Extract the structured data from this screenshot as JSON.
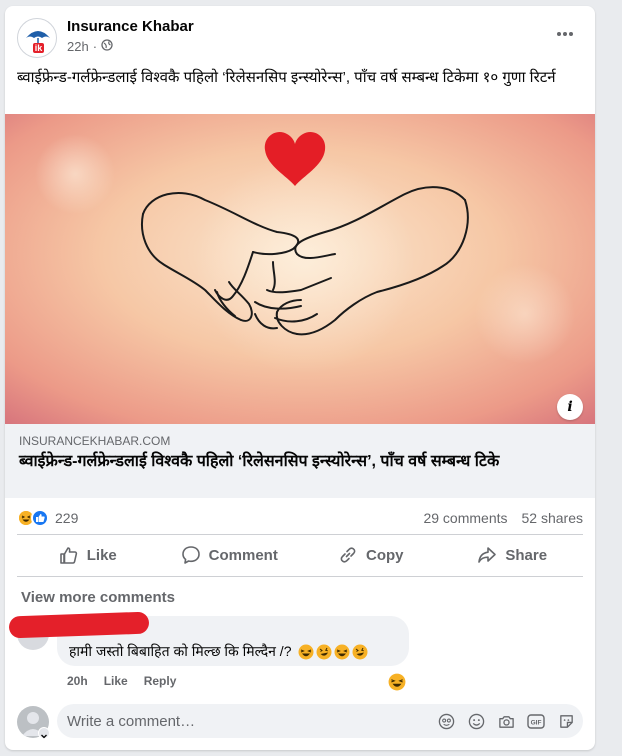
{
  "post": {
    "page_name": "Insurance Khabar",
    "time": "22h",
    "text": "ब्वाईफ्रेन्ड-गर्लफ्रेन्डलाई विश्वकै पहिलो ‘रिलेसनसिप इन्स्योरेन्स’, पाँच वर्ष सम्बन्ध टिकेमा १० गुणा रिटर्न",
    "logo_text": "ik",
    "image_icons": [
      "heart-icon",
      "hands-illustration"
    ]
  },
  "link": {
    "domain": "INSURANCEKHABAR.COM",
    "title": "ब्वाईफ्रेन्ड-गर्लफ्रेन्डलाई विश्वकै पहिलो ‘रिलेसनसिप इन्स्योरेन्स’, पाँच वर्ष सम्बन्ध टिके",
    "info_label": "i"
  },
  "stats": {
    "reaction_count": "229",
    "comments": "29 comments",
    "shares": "52 shares"
  },
  "actions": {
    "like": "Like",
    "comment": "Comment",
    "copy": "Copy",
    "share": "Share"
  },
  "comments": {
    "view_more": "View more comments",
    "items": [
      {
        "text": "हामी जस्तो बिबाहित को मिल्छ कि मिल्दैन /?",
        "time": "20h",
        "like": "Like",
        "reply": "Reply"
      }
    ]
  },
  "composer": {
    "placeholder": "Write a comment…"
  },
  "colors": {
    "accent": "#1877f2",
    "heart": "#e41e26",
    "redaction": "#e4202a",
    "logo_blue": "#1f5fa9"
  }
}
